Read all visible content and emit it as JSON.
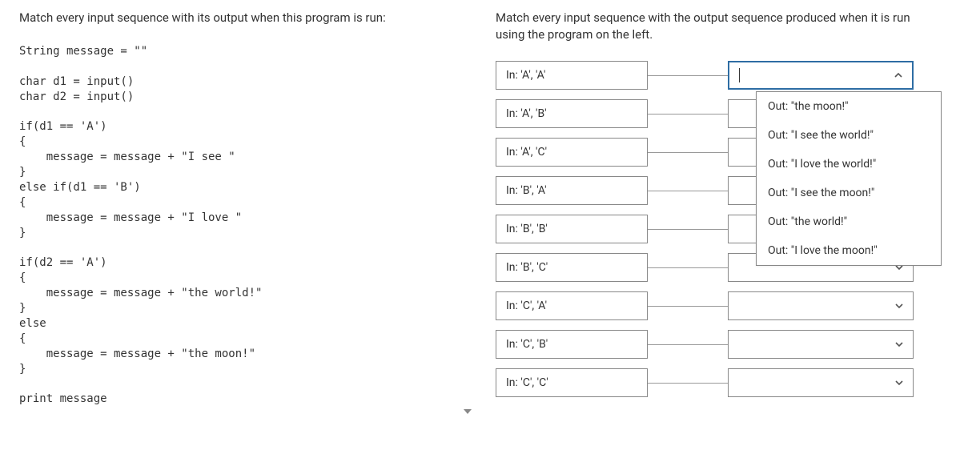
{
  "left": {
    "instruction": "Match every input sequence with its output when this program is run:",
    "code": "String message = \"\"\n\nchar d1 = input()\nchar d2 = input()\n\nif(d1 == 'A')\n{\n    message = message + \"I see \"\n}\nelse if(d1 == 'B')\n{\n    message = message + \"I love \"\n}\n\nif(d2 == 'A')\n{\n    message = message + \"the world!\"\n}\nelse\n{\n    message = message + \"the moon!\"\n}\n\nprint message"
  },
  "right": {
    "instruction": "Match every input sequence with the output sequence produced when it is run using the program on the left.",
    "rows": [
      {
        "input": "In: 'A', 'A'",
        "selected": "",
        "open": true
      },
      {
        "input": "In: 'A', 'B'",
        "selected": "",
        "open": false
      },
      {
        "input": "In: 'A', 'C'",
        "selected": "",
        "open": false
      },
      {
        "input": "In: 'B', 'A'",
        "selected": "",
        "open": false
      },
      {
        "input": "In: 'B', 'B'",
        "selected": "",
        "open": false
      },
      {
        "input": "In: 'B', 'C'",
        "selected": "",
        "open": false
      },
      {
        "input": "In: 'C', 'A'",
        "selected": "",
        "open": false
      },
      {
        "input": "In: 'C', 'B'",
        "selected": "",
        "open": false
      },
      {
        "input": "In: 'C', 'C'",
        "selected": "",
        "open": false
      }
    ],
    "dropdown_options": [
      "Out: \"the moon!\"",
      "Out: \"I see the world!\"",
      "Out: \"I love the world!\"",
      "Out: \"I see the moon!\"",
      "Out: \"the world!\"",
      "Out: \"I love the moon!\""
    ]
  }
}
